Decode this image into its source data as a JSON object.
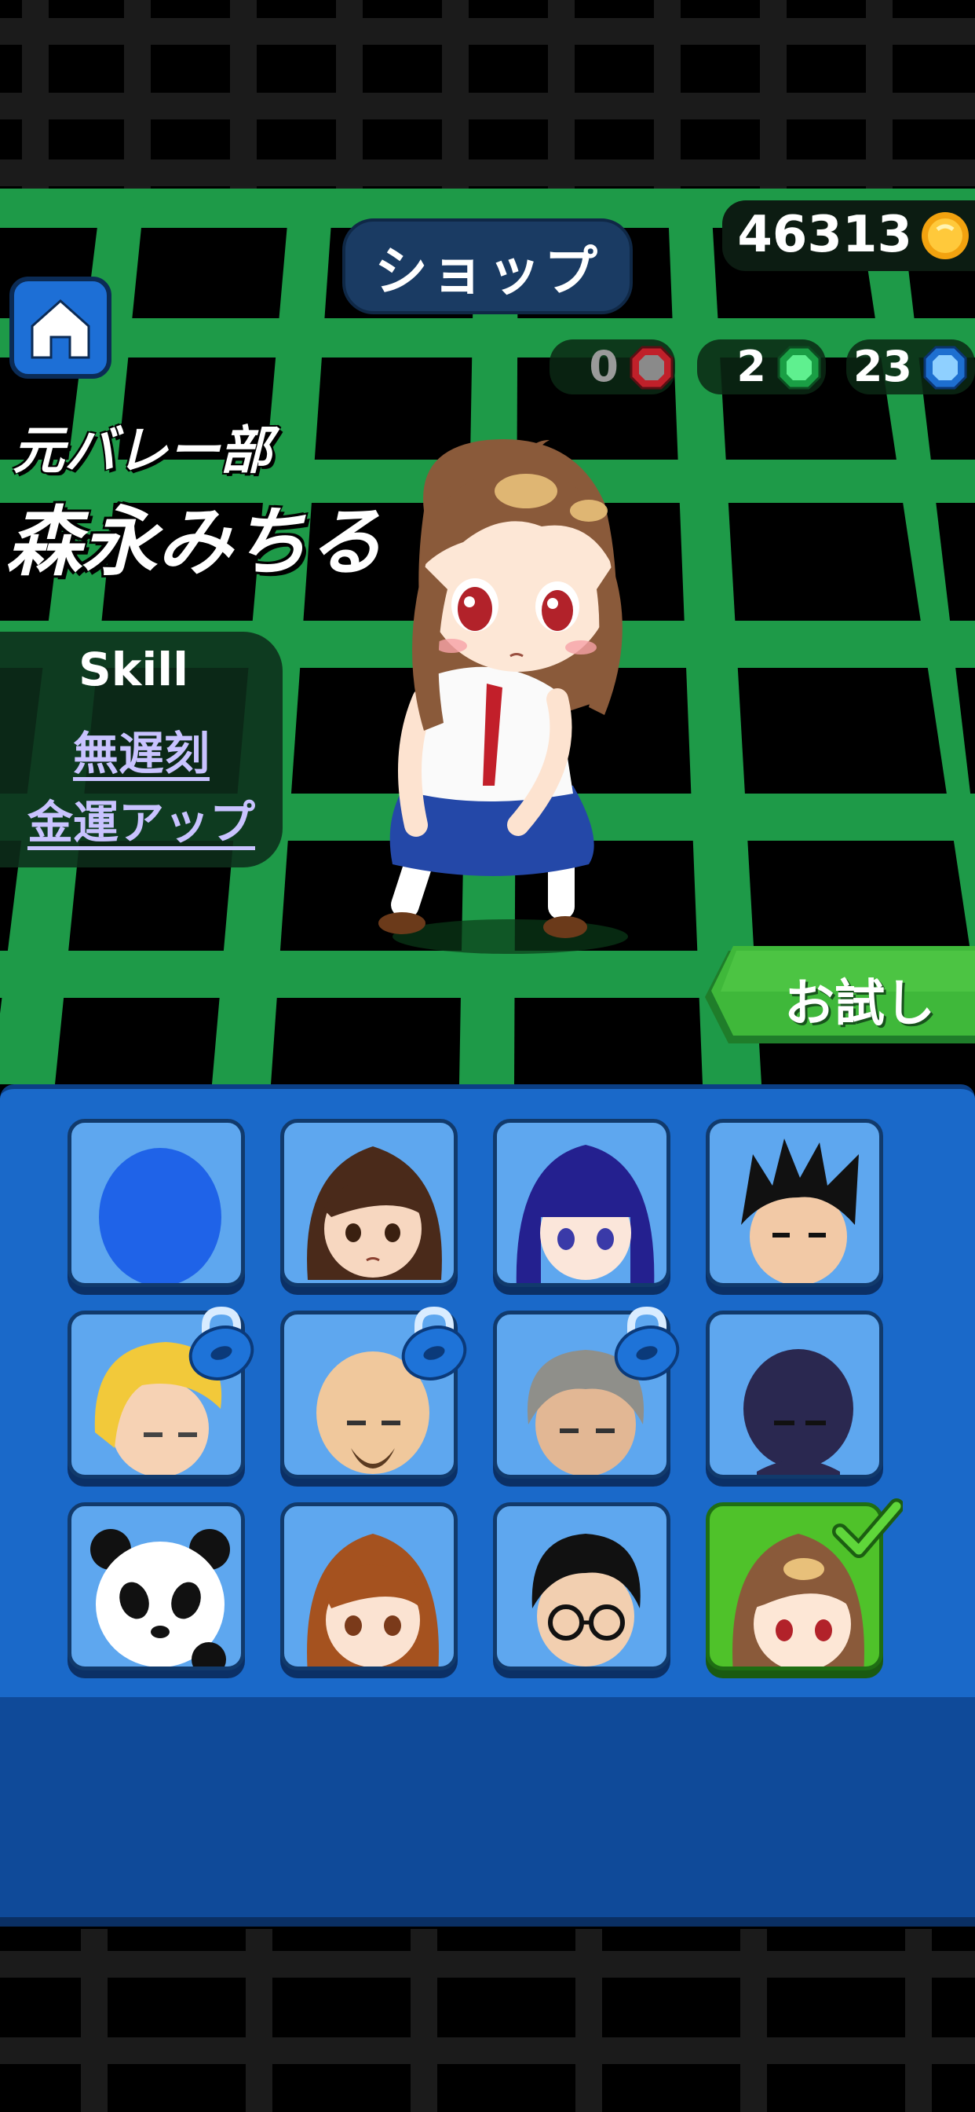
{
  "header": {
    "title": "ショップ",
    "coins": "46313"
  },
  "gems": [
    {
      "count": "0",
      "icon": "red-gem-icon",
      "color": "#c0202a"
    },
    {
      "count": "2",
      "icon": "green-gem-icon",
      "color": "#2fd06a"
    },
    {
      "count": "23",
      "icon": "blue-gem-icon",
      "color": "#3aa0ff"
    }
  ],
  "character": {
    "subtitle": "元バレー部",
    "name": "森永みちる"
  },
  "skill": {
    "title": "Skill",
    "items": [
      "無遅刻",
      "金運アップ"
    ]
  },
  "try_button": {
    "label": "お試し"
  },
  "roster": [
    {
      "name": "blue-silhouette",
      "locked": false,
      "selected": false
    },
    {
      "name": "brown-hair-girl",
      "locked": false,
      "selected": false
    },
    {
      "name": "blue-hair-girl",
      "locked": false,
      "selected": false
    },
    {
      "name": "black-spiky-hair-boy",
      "locked": false,
      "selected": false
    },
    {
      "name": "blonde-boy",
      "locked": true,
      "selected": false
    },
    {
      "name": "bald-bearded-man",
      "locked": true,
      "selected": false
    },
    {
      "name": "gray-hair-old-man",
      "locked": true,
      "selected": false
    },
    {
      "name": "shadow-ninja",
      "locked": false,
      "selected": false
    },
    {
      "name": "panda",
      "locked": false,
      "selected": false
    },
    {
      "name": "auburn-hair-girl",
      "locked": false,
      "selected": false
    },
    {
      "name": "glasses-man",
      "locked": false,
      "selected": false
    },
    {
      "name": "michiru",
      "locked": false,
      "selected": true
    }
  ],
  "colors": {
    "grid_green": "#1e9a48",
    "panel_blue": "#1a69c9",
    "slot_blue": "#5ea7ef",
    "selected_green": "#4fc22a",
    "skill_text": "#c9c3ff"
  }
}
